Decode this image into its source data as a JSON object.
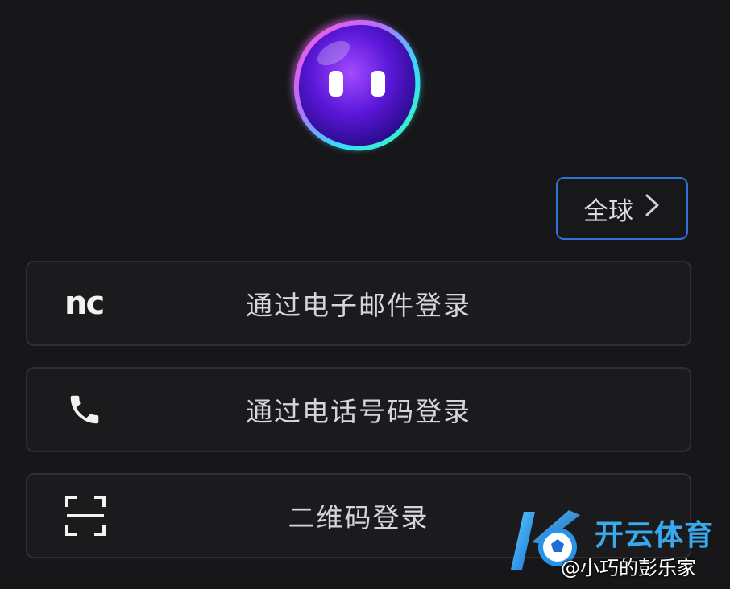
{
  "header": {
    "mascot_icon": "purple-blob-mascot-icon",
    "region": {
      "label": "全球",
      "icon": "chevron-right-icon"
    }
  },
  "login_options": [
    {
      "label": "通过电子邮件登录",
      "icon": "nc-email-icon",
      "icon_text": "nc"
    },
    {
      "label": "通过电话号码登录",
      "icon": "phone-icon"
    },
    {
      "label": "二维码登录",
      "icon": "qr-scan-icon"
    }
  ],
  "watermark": {
    "brand": "开云体育",
    "credit": "@小巧的彭乐家",
    "logo_icon": "k-soccer-logo-icon"
  },
  "colors": {
    "background": "#17171a",
    "region_border": "#2f72d8",
    "button_border": "#2e2e33",
    "brand": "#39a8ec"
  }
}
